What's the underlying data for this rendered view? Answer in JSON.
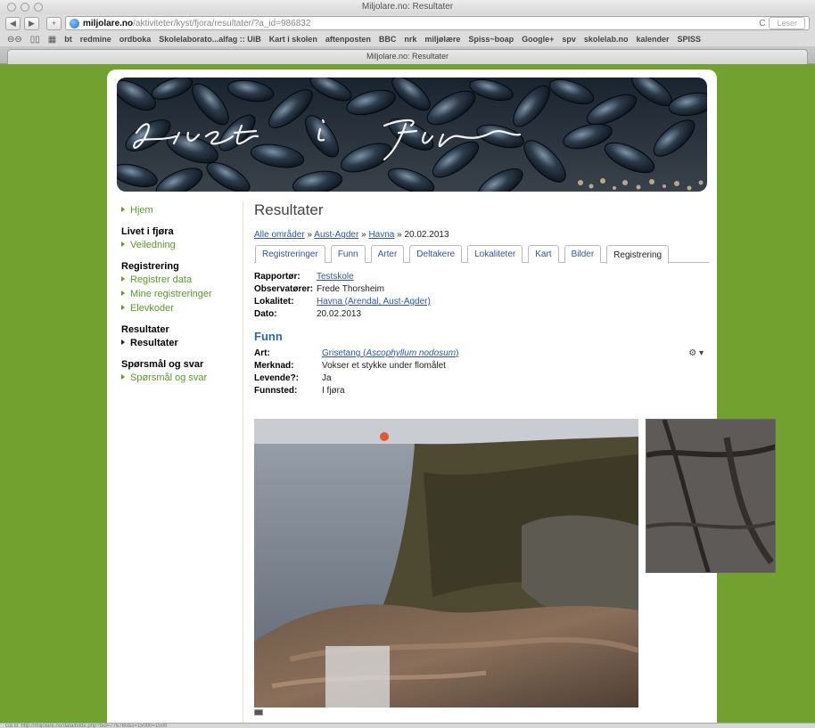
{
  "window": {
    "title": "Miljolare.no: Resultater"
  },
  "toolbar": {
    "back": "◀",
    "forward": "▶",
    "add": "+",
    "url_host": "miljolare.no",
    "url_path": "/aktiviteter/kyst/fjora/resultater/?a_id=986832",
    "reload": "C",
    "reader": "Leser"
  },
  "bookmarks": [
    "bt",
    "redmine",
    "ordboka",
    "Skolelaborato...alfag :: UiB",
    "Kart i skolen",
    "aftenposten",
    "BBC",
    "nrk",
    "miljølære",
    "Spiss~boap",
    "Google+",
    "spv",
    "skolelab.no",
    "kalender",
    "SPISS"
  ],
  "tab": {
    "label": "Miljolare.no: Resultater"
  },
  "banner": {
    "script_text": "Livet i Fjøra"
  },
  "sidebar": {
    "home": "Hjem",
    "groups": [
      {
        "heading": "Livet i fjøra",
        "items": [
          {
            "label": "Veiledning",
            "active": false
          }
        ]
      },
      {
        "heading": "Registrering",
        "items": [
          {
            "label": "Registrer data",
            "active": false
          },
          {
            "label": "Mine registreringer",
            "active": false
          },
          {
            "label": "Elevkoder",
            "active": false
          }
        ]
      },
      {
        "heading": "Resultater",
        "items": [
          {
            "label": "Resultater",
            "active": true
          }
        ]
      },
      {
        "heading": "Spørsmål og svar",
        "items": [
          {
            "label": "Spørsmål og svar",
            "active": false
          }
        ]
      }
    ]
  },
  "main": {
    "title": "Resultater",
    "breadcrumb": {
      "all": "Alle områder",
      "sep1": " » ",
      "county": "Aust-Agder",
      "sep2": " » ",
      "place": "Havna",
      "sep3": " » ",
      "date": "20.02.2013"
    },
    "tabs": [
      {
        "label": "Registreringer",
        "active": false
      },
      {
        "label": "Funn",
        "active": false
      },
      {
        "label": "Arter",
        "active": false
      },
      {
        "label": "Deltakere",
        "active": false
      },
      {
        "label": "Lokaliteter",
        "active": false
      },
      {
        "label": "Kart",
        "active": false
      },
      {
        "label": "Bilder",
        "active": false
      },
      {
        "label": "Registrering",
        "active": true
      }
    ],
    "info": {
      "reporter_label": "Rapportør:",
      "reporter": "Testskole",
      "observers_label": "Observatører:",
      "observers": "Frede Thorsheim",
      "locality_label": "Lokalitet:",
      "locality": "Havna (Arendal, Aust-Agder)",
      "date_label": "Dato:",
      "date": "20.02.2013"
    },
    "finds_title": "Funn",
    "find": {
      "species_label": "Art:",
      "species_name": "Grisetang (",
      "species_latin": "Ascophyllum nodosum",
      "species_close": ")",
      "note_label": "Merknad:",
      "note": "Vokser et stykke under flomålet",
      "alive_label": "Levende?:",
      "alive": "Ja",
      "place_label": "Funnsted:",
      "place": "I fjøra",
      "menu_icon": "⚙ ▾"
    }
  },
  "statusbar": {
    "text": "Gå til: http://miljolare.no/data/bilde.php?bid=776760&s=15000=1500"
  }
}
